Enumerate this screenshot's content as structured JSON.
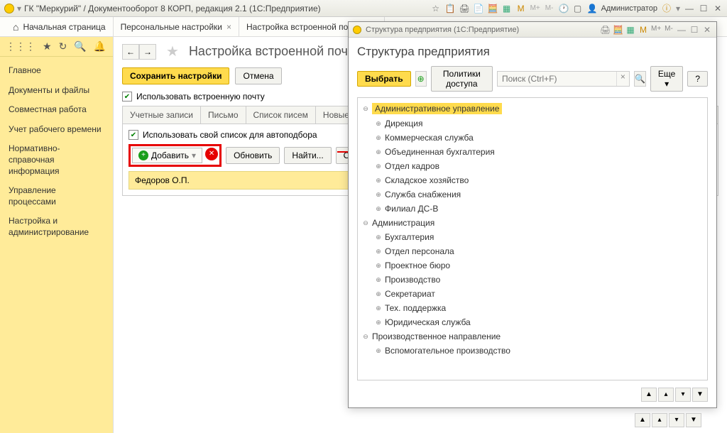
{
  "titlebar": {
    "title": "ГК \"Меркурий\" / Документооборот 8 КОРП, редакция 2.1 (1С:Предприятие)",
    "admin": "Администратор",
    "m_label": "М",
    "mplus": "М+",
    "mminus": "М-"
  },
  "tabs": {
    "home": "Начальная страница",
    "t1": "Персональные настройки",
    "t2": "Настройка встроенной почты *"
  },
  "nav": {
    "i0": "Главное",
    "i1": "Документы и файлы",
    "i2": "Совместная работа",
    "i3": "Учет рабочего времени",
    "i4": "Нормативно-справочная информация",
    "i5": "Управление процессами",
    "i6": "Настройка и администрирование"
  },
  "page": {
    "title": "Настройка встроенной почты *",
    "save": "Сохранить настройки",
    "cancel": "Отмена",
    "use_builtin": "Использовать встроенную почту",
    "subtabs": {
      "st0": "Учетные записи",
      "st1": "Письмо",
      "st2": "Список писем",
      "st3": "Новые письма"
    },
    "use_own_list": "Использовать свой список для автоподбора",
    "add": "Добавить",
    "refresh": "Обновить",
    "find": "Найти...",
    "cancel_find": "Отме",
    "list_item": "Федоров О.П."
  },
  "win2": {
    "titlebar": "Структура предприятия (1С:Предприятие)",
    "heading": "Структура предприятия",
    "select": "Выбрать",
    "policies": "Политики доступа",
    "search_ph": "Поиск (Ctrl+F)",
    "more": "Еще",
    "help": "?",
    "tree": {
      "n0": "Административное управление",
      "n0c": {
        "c0": "Дирекция",
        "c1": "Коммерческая служба",
        "c2": "Объединенная бухгалтерия",
        "c3": "Отдел кадров",
        "c4": "Складское хозяйство",
        "c5": "Служба снабжения",
        "c6": "Филиал ДС-В"
      },
      "n1": "Администрация",
      "n1c": {
        "c0": "Бухгалтерия",
        "c1": "Отдел персонала",
        "c2": "Проектное бюро",
        "c3": "Производство",
        "c4": "Секретариат",
        "c5": "Тех. поддержка",
        "c6": "Юридическая служба"
      },
      "n2": "Производственное направление",
      "n2c": {
        "c0": "Вспомогательное производство"
      }
    }
  }
}
